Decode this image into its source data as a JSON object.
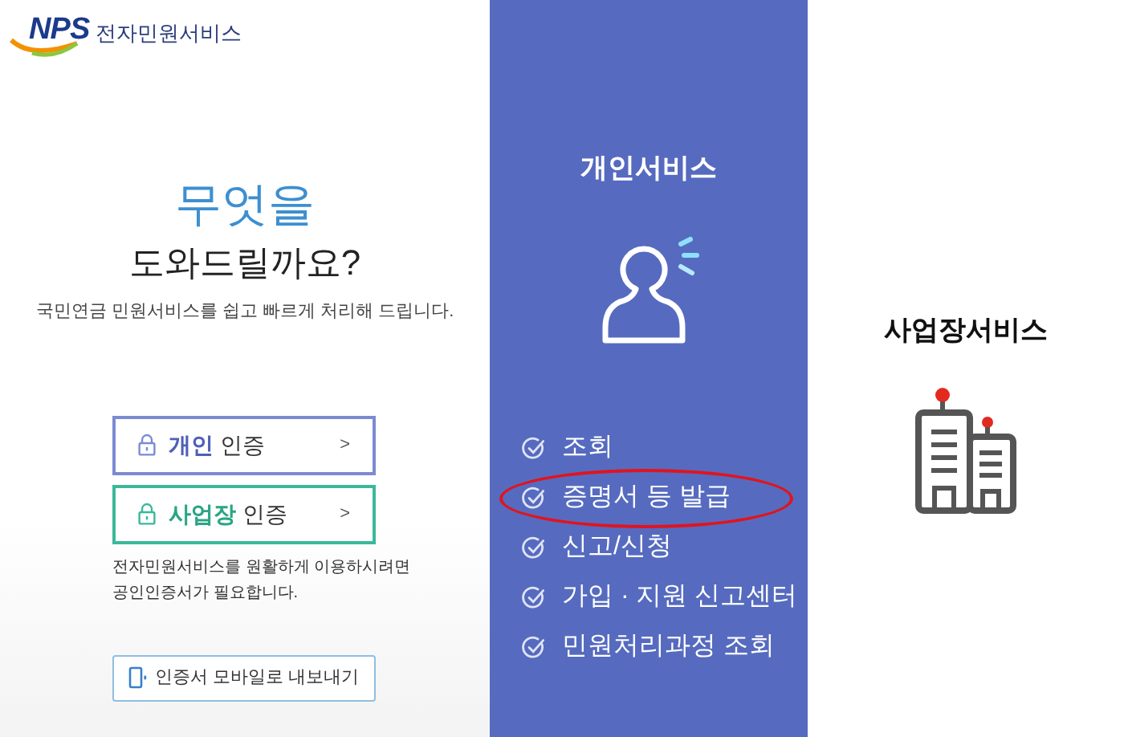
{
  "logo": {
    "brand": "NPS",
    "name": "전자민원서비스"
  },
  "hero": {
    "title": "무엇을",
    "subtitle": "도와드릴까요?",
    "description": "국민연금 민원서비스를 쉽고 빠르게 처리해 드립니다."
  },
  "auth_buttons": [
    {
      "kind": "personal",
      "bold": "개인",
      "label": "인증",
      "arrow": ">"
    },
    {
      "kind": "business",
      "bold": "사업장",
      "label": "인증",
      "arrow": ">"
    }
  ],
  "notice": "전자민원서비스를 원활하게 이용하시려면 공인인증서가 필요합니다.",
  "export_button": "인증서 모바일로 내보내기",
  "personal_service": {
    "title": "개인서비스",
    "items": [
      {
        "label": "조회",
        "circled": false
      },
      {
        "label": "증명서 등 발급",
        "circled": true
      },
      {
        "label": "신고/신청",
        "circled": false
      },
      {
        "label": "가입 · 지원 신고센터",
        "circled": false
      },
      {
        "label": "민원처리과정 조회",
        "circled": false
      }
    ]
  },
  "business_service": {
    "title": "사업장서비스"
  }
}
